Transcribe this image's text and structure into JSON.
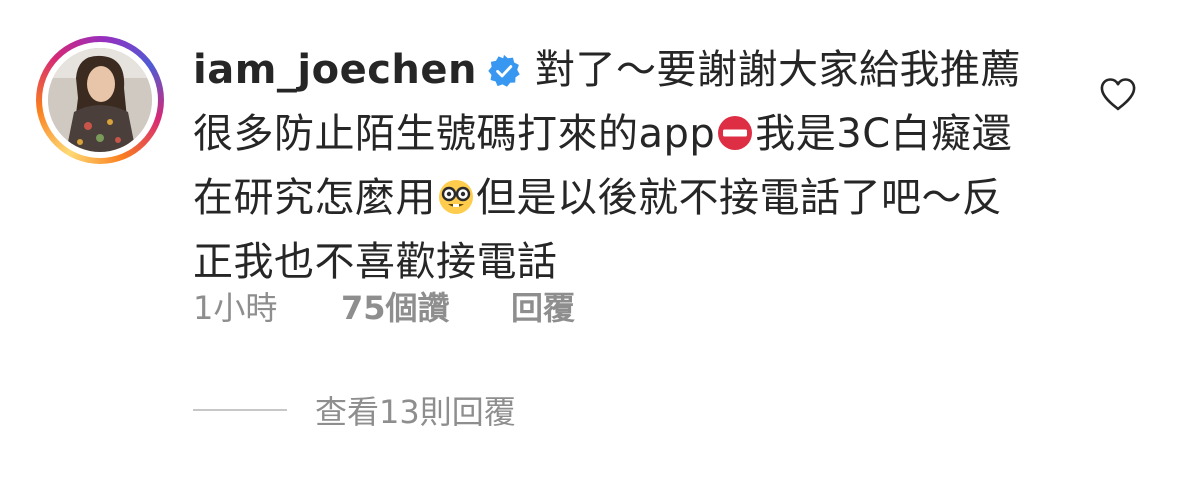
{
  "comment": {
    "username": "iam_joechen",
    "verified": true,
    "text_part1": "對了～要謝謝大家給我推薦很多防止陌生號碼打來的app",
    "emoji1": "no-entry-emoji",
    "text_part2": "我是3C白癡還在研究怎麼用",
    "emoji2": "nerd-face-emoji",
    "text_part3": "但是以後就不接電話了吧～反正我也不喜歡接電話",
    "time": "1小時",
    "likes": "75個讚",
    "reply_label": "回覆",
    "view_replies_label": "查看13則回覆"
  },
  "colors": {
    "text": "#262626",
    "muted": "#8e8e8e",
    "verified_blue": "#3897f0",
    "divider": "#c7c7c7"
  },
  "icons": {
    "verified": "verified-badge-icon",
    "like": "heart-outline-icon"
  }
}
